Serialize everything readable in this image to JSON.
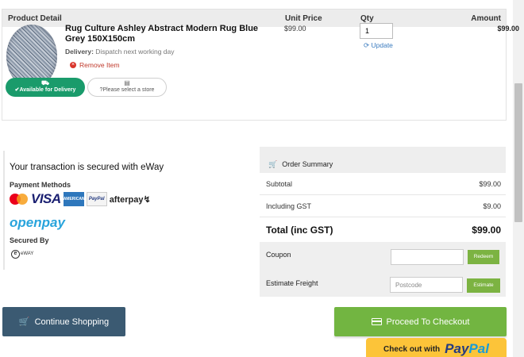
{
  "cart": {
    "headers": {
      "product": "Product Detail",
      "unit_price": "Unit Price",
      "qty": "Qty",
      "amount": "Amount"
    },
    "item": {
      "title": "Rug Culture Ashley Abstract Modern Rug Blue Grey 150X150cm",
      "delivery_label": "Delivery:",
      "delivery_text": "Dispatch next working day",
      "remove": "Remove Item",
      "available_pill": "Available for Delivery",
      "store_pill": "Please select a store",
      "unit_price": "$99.00",
      "qty": "1",
      "update": "Update",
      "amount": "$99.00"
    }
  },
  "security": {
    "title": "Your transaction is secured with eWay",
    "payment_methods_label": "Payment Methods",
    "logos": {
      "visa": "VISA",
      "amex": "AMERICAN EXPRESS",
      "paypal": "PayPal",
      "afterpay": "afterpay",
      "openpay": "openpay"
    },
    "secured_by_label": "Secured By",
    "eway": "eWAY"
  },
  "summary": {
    "title": "Order Summary",
    "subtotal_label": "Subtotal",
    "subtotal": "$99.00",
    "gst_label": "Including GST",
    "gst": "$9.00",
    "total_label": "Total (inc GST)",
    "total": "$99.00",
    "coupon_label": "Coupon",
    "redeem": "Redeem",
    "freight_label": "Estimate Freight",
    "postcode_placeholder": "Postcode",
    "estimate": "Estimate"
  },
  "actions": {
    "continue": "Continue Shopping",
    "checkout": "Proceed To Checkout",
    "paypal_prefix": "Check out with",
    "paypal_p1": "Pay",
    "paypal_p2": "Pal"
  },
  "colors": {
    "green_pill": "#1a9b6b",
    "checkout_green": "#72b541",
    "continue_blue": "#3b5a72",
    "paypal_yellow": "#fcc439",
    "remove_red": "#c0392b"
  }
}
